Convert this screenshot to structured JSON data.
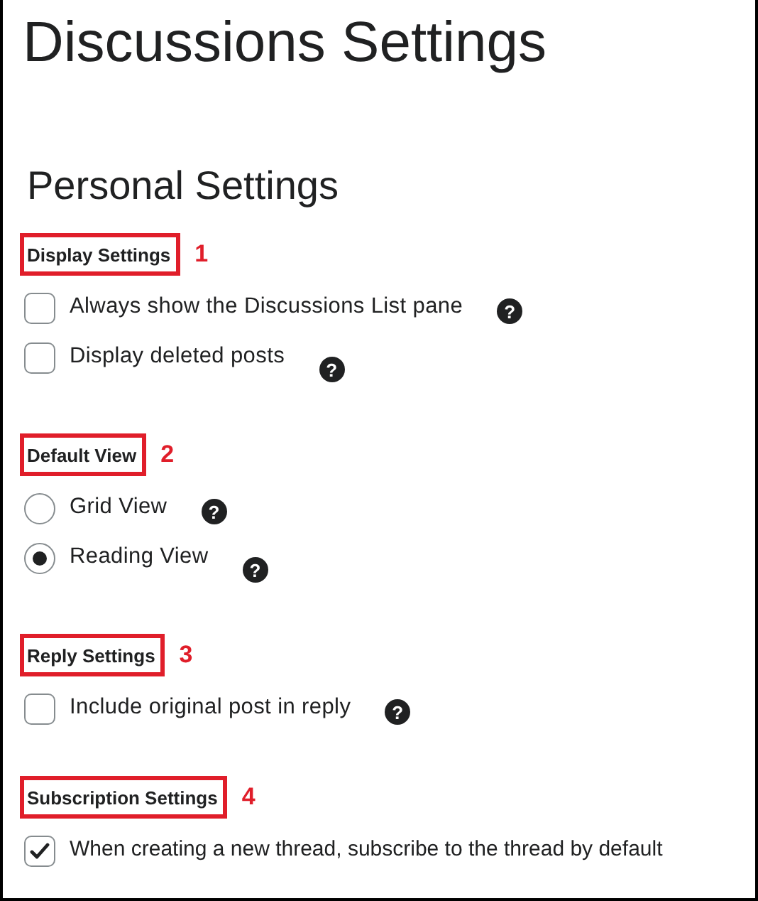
{
  "page_title": "Discussions Settings",
  "section_title": "Personal Settings",
  "groups": [
    {
      "heading": "Display Settings",
      "callout": "1",
      "options": [
        {
          "kind": "checkbox",
          "label": "Always show the Discussions List pane",
          "checked": false,
          "help": "?"
        },
        {
          "kind": "checkbox",
          "label": "Display deleted posts",
          "checked": false,
          "help": "?"
        }
      ]
    },
    {
      "heading": "Default View",
      "callout": "2",
      "options": [
        {
          "kind": "radio",
          "label": "Grid View",
          "selected": false,
          "help": "?"
        },
        {
          "kind": "radio",
          "label": "Reading View",
          "selected": true,
          "help": "?"
        }
      ]
    },
    {
      "heading": "Reply Settings",
      "callout": "3",
      "options": [
        {
          "kind": "checkbox",
          "label": "Include original post in reply",
          "checked": false,
          "help": "?"
        }
      ]
    },
    {
      "heading": "Subscription Settings",
      "callout": "4",
      "options": [
        {
          "kind": "checkbox",
          "label": "When creating a new thread, subscribe to the thread by default",
          "checked": true
        }
      ]
    }
  ]
}
